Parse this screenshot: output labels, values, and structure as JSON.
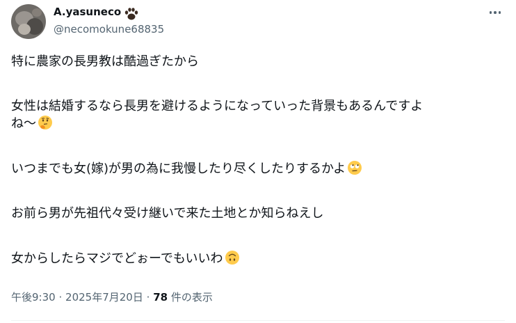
{
  "author": {
    "display_name": "A.yasuneco",
    "handle": "@necomokune68835",
    "badge_icon": "paw-icon"
  },
  "more_button": {
    "icon": "more-dots-icon"
  },
  "post": {
    "lines": [
      "特に農家の長男教は酷過ぎたから",
      "女性は結婚するなら長男を避けるようになっていった背景もあるんですよ",
      "ね～",
      "いつまでも女(嫁)が男の為に我慢したり尽くしたりするかよ",
      "お前ら男が先祖代々受け継いで来た土地とか知らねえし",
      "女からしたらマジでどぉーでもいいわ"
    ],
    "emojis": {
      "line3": "thinking-face-emoji",
      "line4": "face-with-rolling-eyes-emoji",
      "line6": "upside-down-face-emoji"
    }
  },
  "meta": {
    "time": "午後9:30",
    "separator1": "·",
    "date": "2025年7月20日",
    "separator2": "·",
    "views_count": "78",
    "views_label": "件の表示"
  },
  "colors": {
    "text": "#0f1419",
    "secondary": "#536471",
    "divider": "#eff3f4",
    "emoji_yellow": "#ffcb4c"
  }
}
